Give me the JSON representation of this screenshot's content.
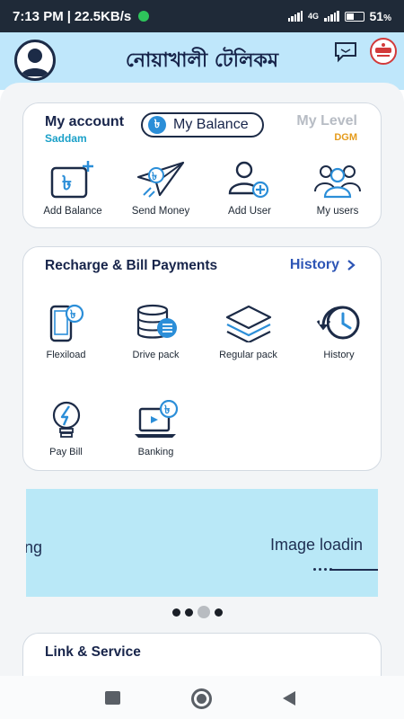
{
  "status_bar": {
    "time": "7:13 PM",
    "separator": "|",
    "speed": "22.5KB/s",
    "network": "4G",
    "battery": "51",
    "battery_unit": "%",
    "battery_level": 0.51
  },
  "header": {
    "title": "নোয়াখালী টেলিকম",
    "icons": [
      "avatar-icon",
      "chat-icon",
      "brand-logo"
    ]
  },
  "account": {
    "title": "My account",
    "username": "Saddam",
    "balance_label": "My Balance",
    "balance_icon_glyph": "৳",
    "level_label": "My Level",
    "level_value": "DGM"
  },
  "quick_actions": [
    {
      "label": "Add Balance",
      "icon": "add-balance-icon"
    },
    {
      "label": "Send Money",
      "icon": "send-money-icon"
    },
    {
      "label": "Add User",
      "icon": "add-user-icon"
    },
    {
      "label": "My users",
      "icon": "my-users-icon"
    }
  ],
  "recharge": {
    "title": "Recharge & Bill Payments",
    "history_link": "History",
    "items": [
      {
        "label": "Flexiload",
        "icon": "flexiload-icon"
      },
      {
        "label": "Drive pack",
        "icon": "drive-pack-icon"
      },
      {
        "label": "Regular pack",
        "icon": "regular-pack-icon"
      },
      {
        "label": "History",
        "icon": "history-icon"
      },
      {
        "label": "Pay Bill",
        "icon": "pay-bill-icon"
      },
      {
        "label": "Banking",
        "icon": "banking-icon"
      }
    ]
  },
  "banner": {
    "left_text": "ng",
    "right_text": "Image loadin",
    "pages": 4,
    "active_page": 3
  },
  "link_service": {
    "title": "Link & Service"
  },
  "colors": {
    "header_bg": "#bfe7fb",
    "primary": "#17244a",
    "accent": "#2b8ed8",
    "link": "#2d55b5",
    "level": "#e59b1b"
  }
}
